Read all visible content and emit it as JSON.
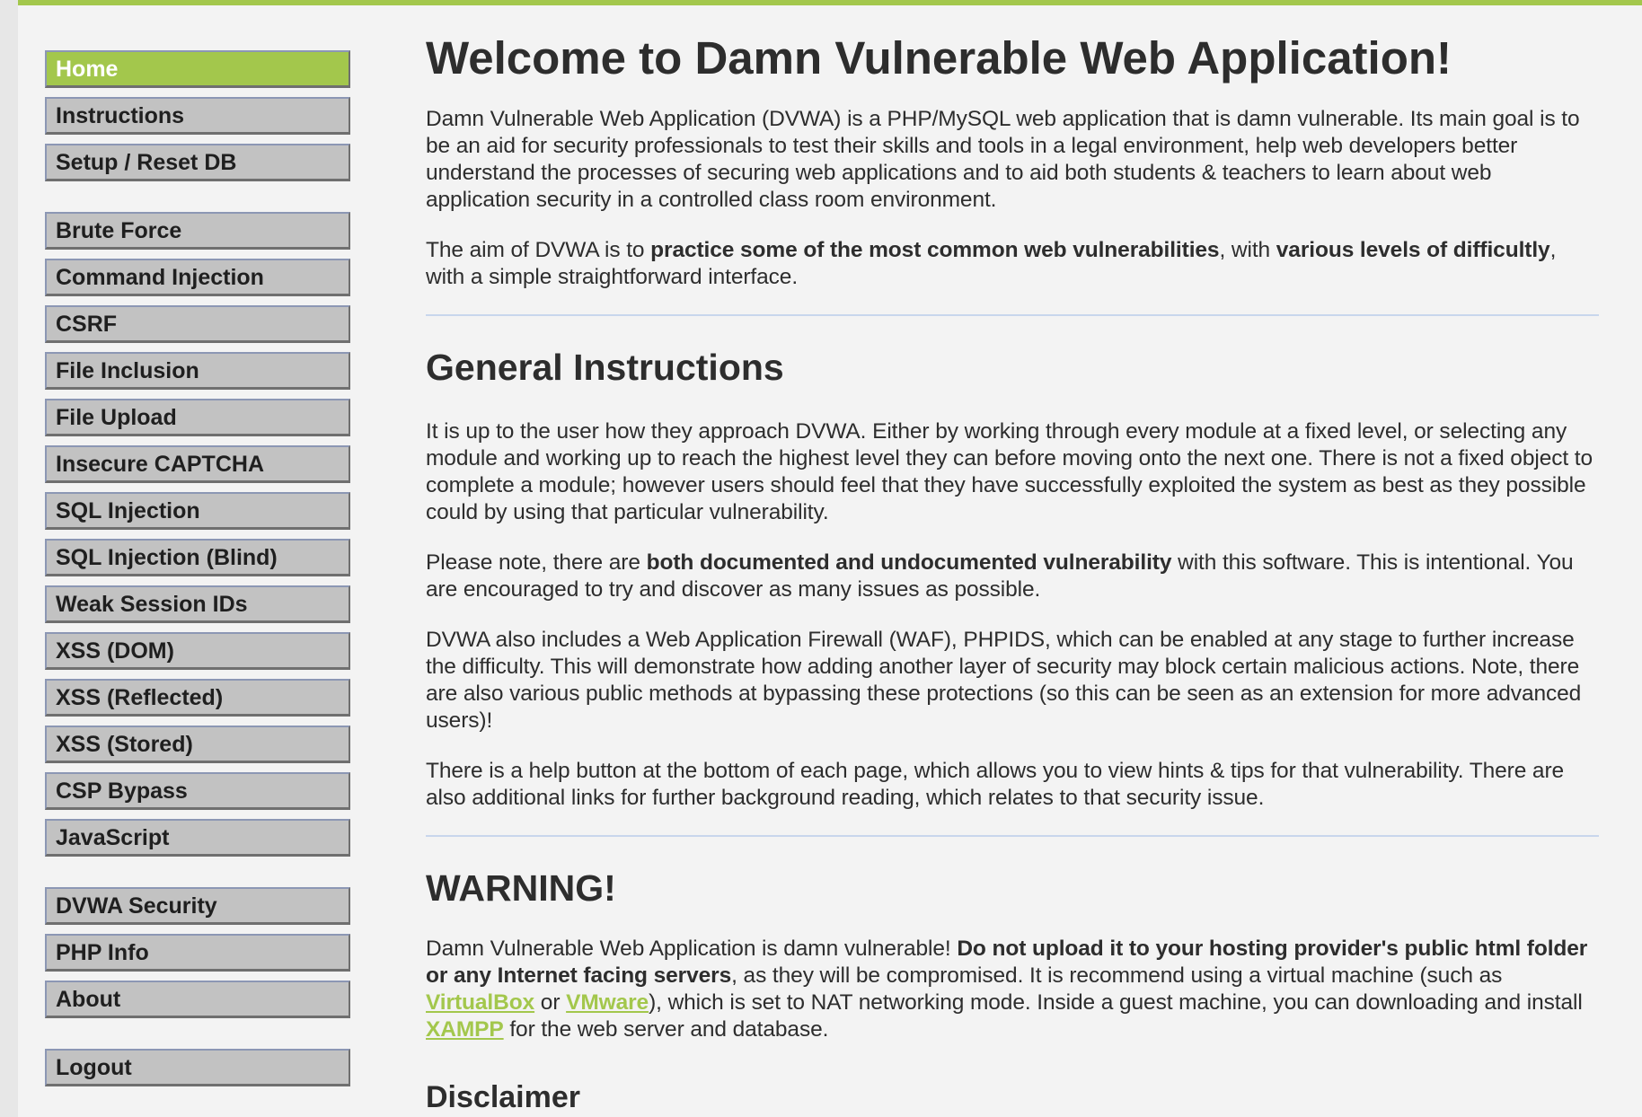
{
  "sidebar": {
    "groups": [
      [
        {
          "label": "Home",
          "selected": true
        },
        {
          "label": "Instructions"
        },
        {
          "label": "Setup / Reset DB"
        }
      ],
      [
        {
          "label": "Brute Force"
        },
        {
          "label": "Command Injection"
        },
        {
          "label": "CSRF"
        },
        {
          "label": "File Inclusion"
        },
        {
          "label": "File Upload"
        },
        {
          "label": "Insecure CAPTCHA"
        },
        {
          "label": "SQL Injection"
        },
        {
          "label": "SQL Injection (Blind)"
        },
        {
          "label": "Weak Session IDs"
        },
        {
          "label": "XSS (DOM)"
        },
        {
          "label": "XSS (Reflected)"
        },
        {
          "label": "XSS (Stored)"
        },
        {
          "label": "CSP Bypass"
        },
        {
          "label": "JavaScript"
        }
      ],
      [
        {
          "label": "DVWA Security"
        },
        {
          "label": "PHP Info"
        },
        {
          "label": "About"
        }
      ],
      [
        {
          "label": "Logout"
        }
      ]
    ]
  },
  "main": {
    "title": "Welcome to Damn Vulnerable Web Application!",
    "intro": "Damn Vulnerable Web Application (DVWA) is a PHP/MySQL web application that is damn vulnerable. Its main goal is to be an aid for security professionals to test their skills and tools in a legal environment, help web developers better understand the processes of securing web applications and to aid both students & teachers to learn about web application security in a controlled class room environment.",
    "aim": {
      "t1": "The aim of DVWA is to ",
      "b1": "practice some of the most common web vulnerabilities",
      "t2": ", with ",
      "b2": "various levels of difficultly",
      "t3": ", with a simple straightforward interface."
    },
    "general": {
      "heading": "General Instructions",
      "p1": "It is up to the user how they approach DVWA. Either by working through every module at a fixed level, or selecting any module and working up to reach the highest level they can before moving onto the next one. There is not a fixed object to complete a module; however users should feel that they have successfully exploited the system as best as they possible could by using that particular vulnerability.",
      "p2": {
        "t1": "Please note, there are ",
        "b1": "both documented and undocumented vulnerability",
        "t2": " with this software. This is intentional. You are encouraged to try and discover as many issues as possible."
      },
      "p3": "DVWA also includes a Web Application Firewall (WAF), PHPIDS, which can be enabled at any stage to further increase the difficulty. This will demonstrate how adding another layer of security may block certain malicious actions. Note, there are also various public methods at bypassing these protections (so this can be seen as an extension for more advanced users)!",
      "p4": "There is a help button at the bottom of each page, which allows you to view hints & tips for that vulnerability. There are also additional links for further background reading, which relates to that security issue."
    },
    "warning": {
      "heading": "WARNING!",
      "t1": "Damn Vulnerable Web Application is damn vulnerable! ",
      "b1": "Do not upload it to your hosting provider's public html folder or any Internet facing servers",
      "t2": ", as they will be compromised. It is recommend using a virtual machine (such as ",
      "link1": "VirtualBox",
      "t3": " or ",
      "link2": "VMware",
      "t4": "), which is set to NAT networking mode. Inside a guest machine, you can downloading and install ",
      "link3": "XAMPP",
      "t5": " for the web server and database."
    },
    "disclaimer": {
      "heading": "Disclaimer"
    }
  },
  "colors": {
    "accent": "#a3c74c",
    "menu_bg": "#c2c2c2",
    "page_bg": "#f3f3f3",
    "separator": "#c8d6ec"
  }
}
